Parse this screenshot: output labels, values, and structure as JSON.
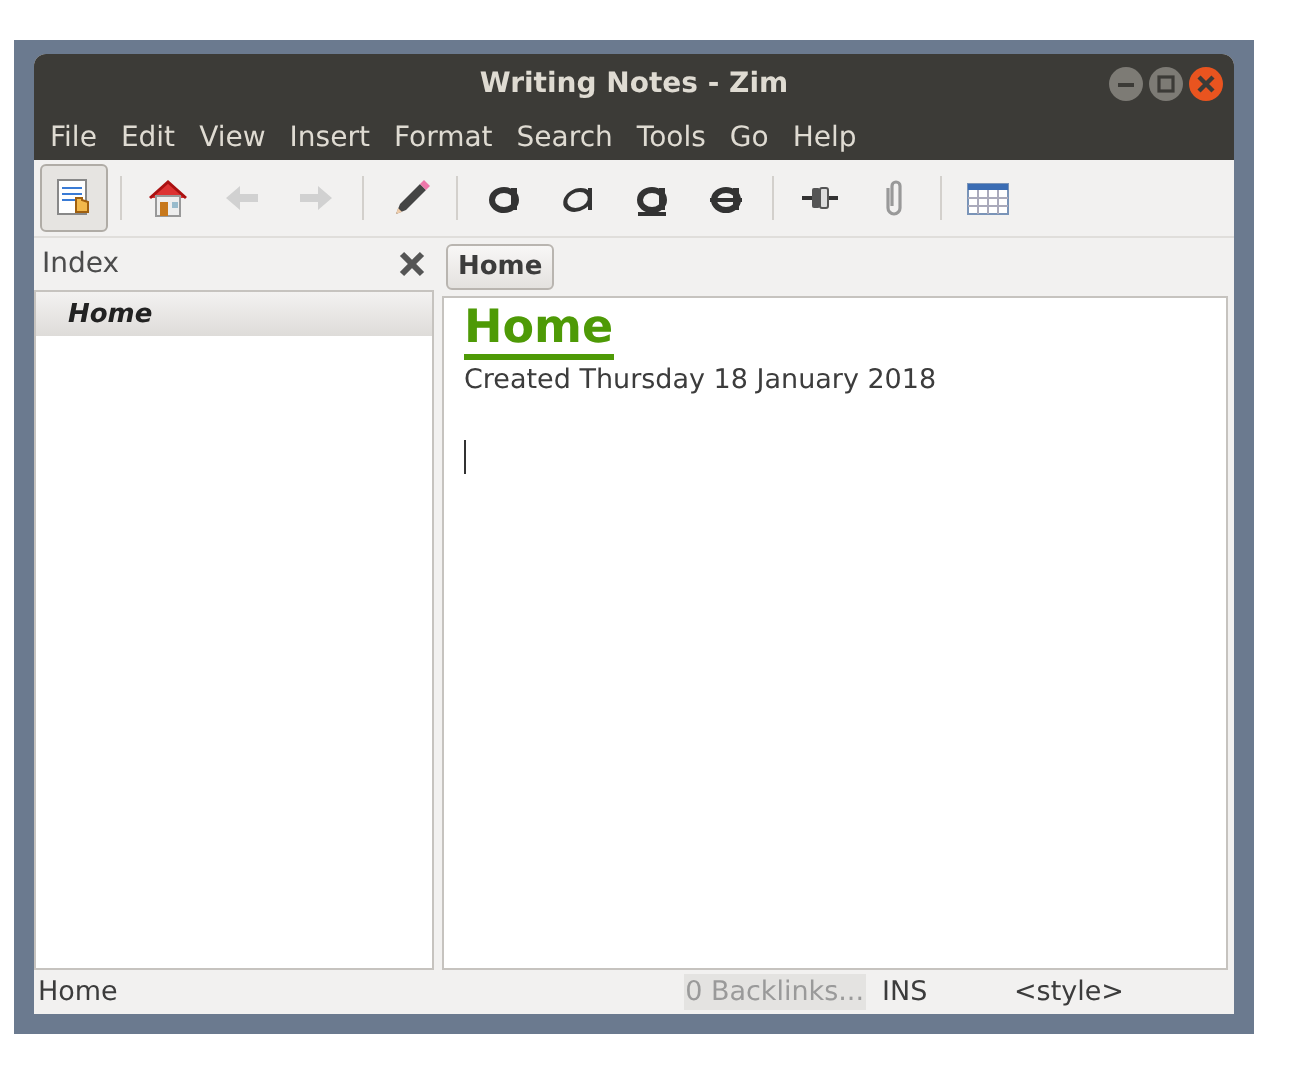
{
  "window": {
    "title": "Writing Notes - Zim",
    "controls": [
      {
        "kind": "minimize"
      },
      {
        "kind": "maximize"
      },
      {
        "kind": "close"
      }
    ]
  },
  "menu": [
    "File",
    "Edit",
    "View",
    "Insert",
    "Format",
    "Search",
    "Tools",
    "Go",
    "Help"
  ],
  "toolbar": [
    [
      {
        "kind": "index",
        "pressed": true,
        "disabled": false
      }
    ],
    [
      {
        "kind": "home",
        "pressed": false,
        "disabled": false
      },
      {
        "kind": "back",
        "pressed": false,
        "disabled": true
      },
      {
        "kind": "forward",
        "pressed": false,
        "disabled": true
      }
    ],
    [
      {
        "kind": "edit",
        "pressed": false,
        "disabled": false
      }
    ],
    [
      {
        "kind": "bold",
        "pressed": false,
        "disabled": false
      },
      {
        "kind": "italic",
        "pressed": false,
        "disabled": false
      },
      {
        "kind": "underline",
        "pressed": false,
        "disabled": false
      },
      {
        "kind": "strike",
        "pressed": false,
        "disabled": false
      }
    ],
    [
      {
        "kind": "link",
        "pressed": false,
        "disabled": false
      },
      {
        "kind": "attach",
        "pressed": false,
        "disabled": false
      }
    ],
    [
      {
        "kind": "table",
        "pressed": false,
        "disabled": false
      }
    ]
  ],
  "index": {
    "title": "Index",
    "items": [
      {
        "label": "Home",
        "selected": true
      }
    ]
  },
  "pathbar": [
    {
      "label": "Home",
      "selected": true
    }
  ],
  "page": {
    "heading": "Home",
    "created": "Created Thursday 18 January 2018"
  },
  "status_bar": {
    "page": "Home",
    "backlinks": "0 Backlinks...",
    "mode": "INS",
    "style": "<style>"
  }
}
